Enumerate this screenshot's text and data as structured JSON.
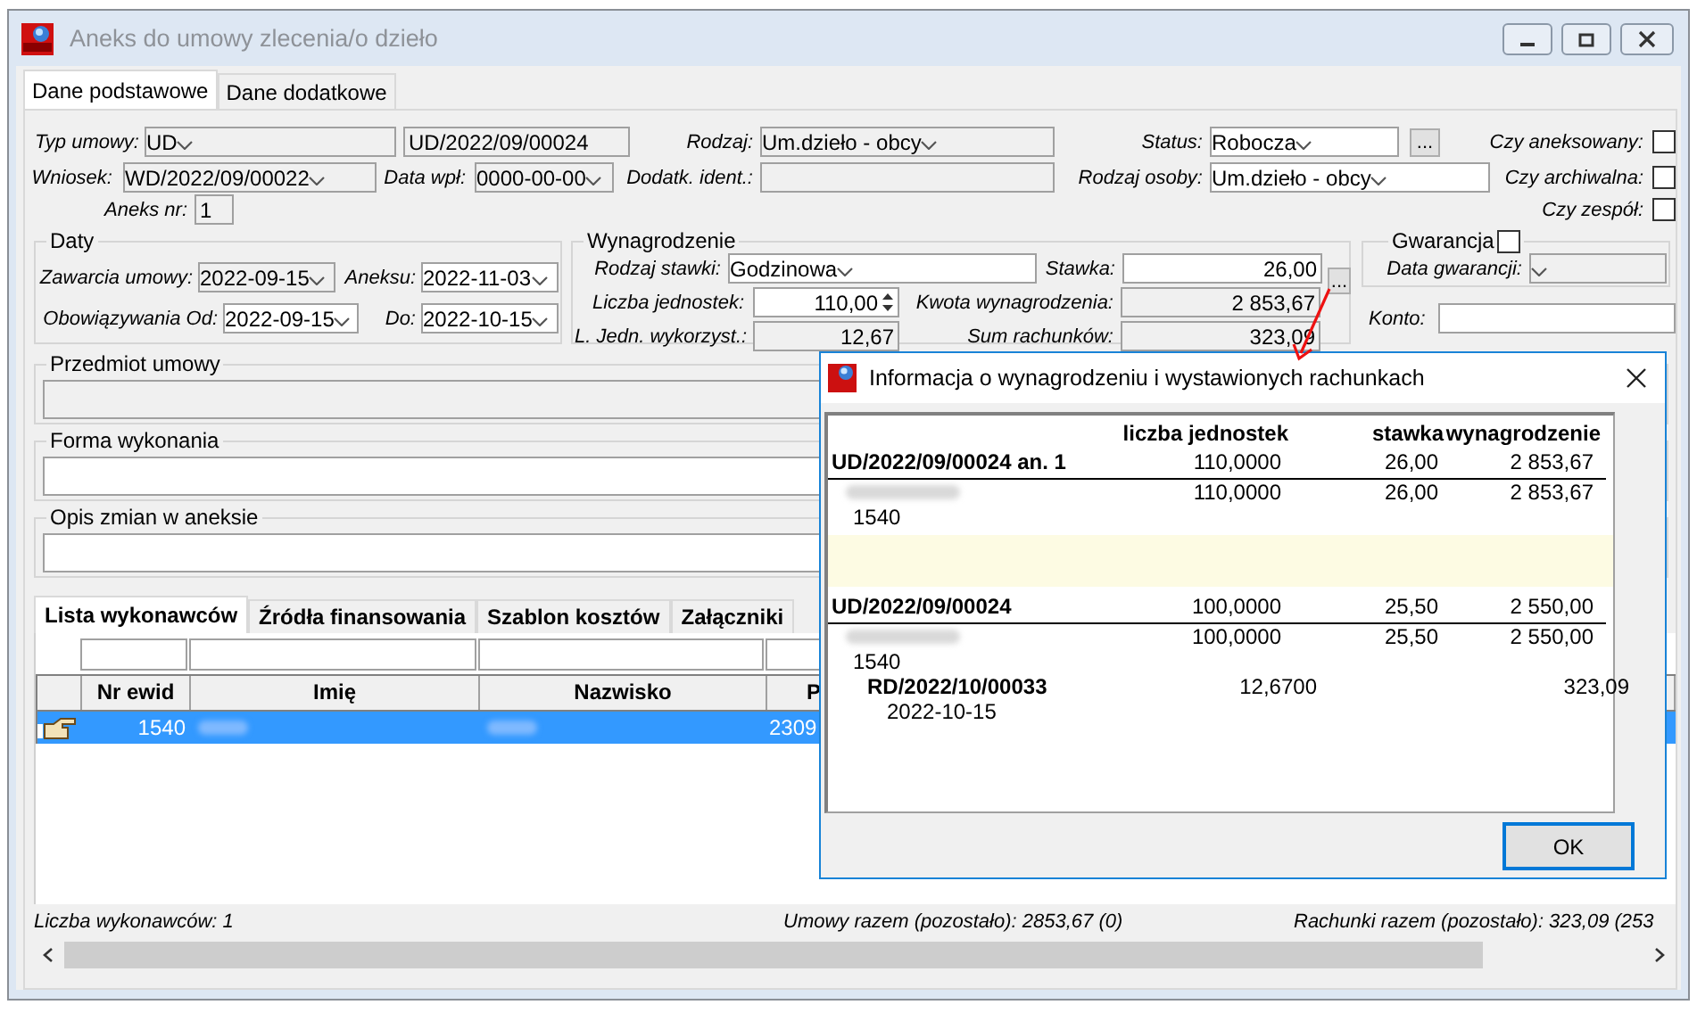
{
  "window": {
    "title": "Aneks do umowy zlecenia/o dzieło"
  },
  "tabs": [
    {
      "label": "Dane podstawowe",
      "selected": true
    },
    {
      "label": "Dane dodatkowe",
      "selected": false
    }
  ],
  "header_rows": [
    [
      {
        "kind": "label",
        "text": "Typ umowy:"
      },
      {
        "kind": "combo",
        "value": "UD",
        "readonly": true
      },
      {
        "kind": "field",
        "value": "UD/2022/09/00024",
        "readonly": true
      },
      {
        "kind": "label",
        "text": "Rodzaj:"
      },
      {
        "kind": "combo",
        "value": "Um.dzieło - obcy",
        "readonly": true
      },
      {
        "kind": "label",
        "text": "Status:"
      },
      {
        "kind": "combo",
        "value": "Robocza",
        "readonly": false
      },
      {
        "kind": "button",
        "text": "..."
      },
      {
        "kind": "label",
        "text": "Czy aneksowany:"
      },
      {
        "kind": "checkbox",
        "checked": false
      }
    ],
    [
      {
        "kind": "label",
        "text": "Wniosek:"
      },
      {
        "kind": "combo",
        "value": "WD/2022/09/00022",
        "readonly": true
      },
      {
        "kind": "label",
        "text": "Data wpł:"
      },
      {
        "kind": "combo",
        "value": "0000-00-00",
        "readonly": true
      },
      {
        "kind": "label",
        "text": "Dodatk. ident.:"
      },
      {
        "kind": "field",
        "readonly": true
      },
      {
        "kind": "label",
        "text": "Rodzaj osoby:"
      },
      {
        "kind": "combo",
        "value": "Um.dzieło - obcy",
        "readonly": false
      },
      {
        "kind": "label",
        "text": "Czy archiwalna:"
      },
      {
        "kind": "checkbox",
        "checked": false
      }
    ],
    [
      {
        "kind": "label",
        "text": "Aneks nr:"
      },
      {
        "kind": "field",
        "value": "1",
        "readonly": true
      },
      {
        "kind": "label",
        "text": "Czy zespół:"
      },
      {
        "kind": "checkbox",
        "checked": false
      }
    ]
  ],
  "daty": {
    "title": "Daty",
    "rows": [
      [
        {
          "kind": "label",
          "text": "Zawarcia umowy:"
        },
        {
          "kind": "combo",
          "value": "2022-09-15",
          "readonly": true
        },
        {
          "kind": "label",
          "text": "Aneksu:"
        },
        {
          "kind": "combo",
          "value": "2022-11-03",
          "readonly": false
        }
      ],
      [
        {
          "kind": "label",
          "text": "Obowiązywania Od:"
        },
        {
          "kind": "combo",
          "value": "2022-09-15",
          "readonly": false
        },
        {
          "kind": "label",
          "text": "Do:"
        },
        {
          "kind": "combo",
          "value": "2022-10-15",
          "readonly": false
        }
      ]
    ]
  },
  "wynagrodzenie": {
    "title": "Wynagrodzenie",
    "button": "...",
    "rows": [
      [
        {
          "kind": "label",
          "text": "Rodzaj stawki:"
        },
        {
          "kind": "combo",
          "value": "Godzinowa",
          "readonly": false
        },
        {
          "kind": "label",
          "text": "Stawka:"
        },
        {
          "kind": "number",
          "value": "26,00",
          "readonly": false
        }
      ],
      [
        {
          "kind": "label",
          "text": "Liczba jednostek:"
        },
        {
          "kind": "spin",
          "value": "110,00",
          "readonly": false
        },
        {
          "kind": "label",
          "text": "Kwota wynagrodzenia:"
        },
        {
          "kind": "number",
          "value": "2 853,67",
          "readonly": true
        }
      ],
      [
        {
          "kind": "label",
          "text": "L. Jedn. wykorzyst.:"
        },
        {
          "kind": "number",
          "value": "12,67",
          "readonly": true
        },
        {
          "kind": "label",
          "text": "Sum rachunków:"
        },
        {
          "kind": "number",
          "value": "323,09",
          "readonly": true
        }
      ]
    ]
  },
  "gwarancja": {
    "title": "Gwarancja",
    "checked": false,
    "rows": [
      [
        {
          "kind": "label",
          "text": "Data gwarancji:"
        },
        {
          "kind": "combo",
          "readonly": true
        }
      ]
    ]
  },
  "konto": {
    "label": "Konto:"
  },
  "text_groups": [
    {
      "title": "Przedmiot umowy",
      "readonly": true
    },
    {
      "title": "Forma wykonania",
      "readonly": false
    },
    {
      "title": "Opis zmian w aneksie",
      "readonly": false
    }
  ],
  "lower_tabs": [
    {
      "label": "Lista wykonawców",
      "selected": true
    },
    {
      "label": "Źródła finansowania",
      "selected": false
    },
    {
      "label": "Szablon kosztów",
      "selected": false
    },
    {
      "label": "Załączniki",
      "selected": false
    }
  ],
  "grid": {
    "columns": [
      "Nr ewid",
      "Imię",
      "Nazwisko",
      "P"
    ],
    "rows": [
      {
        "nr_ewid": "1540",
        "column_4": "2309",
        "selected": true
      }
    ]
  },
  "footer": [
    "Liczba wykonawców: 1",
    "Umowy razem (pozostało): 2853,67 (0)",
    "Rachunki razem (pozostało): 323,09 (253"
  ],
  "info_dialog": {
    "title": "Informacja o wynagrodzeniu i wystawionych rachunkach",
    "columns": [
      "liczba jednostek",
      "stawka",
      "wynagrodzenie"
    ],
    "button": "OK",
    "sections": [
      {
        "contract": "UD/2022/09/00024 an. 1",
        "units": "110,0000",
        "rate": "26,00",
        "amount": "2 853,67",
        "persons": [
          {
            "id": "1540",
            "units": "110,0000",
            "rate": "26,00",
            "amount": "2 853,67"
          }
        ]
      },
      {
        "contract": "UD/2022/09/00024",
        "units": "100,0000",
        "rate": "25,50",
        "amount": "2 550,00",
        "persons": [
          {
            "id": "1540",
            "units": "100,0000",
            "rate": "25,50",
            "amount": "2 550,00",
            "invoices": [
              {
                "number": "RD/2022/10/00033",
                "date": "2022-10-15",
                "units": "12,6700",
                "amount": "323,09"
              }
            ]
          }
        ]
      }
    ]
  }
}
